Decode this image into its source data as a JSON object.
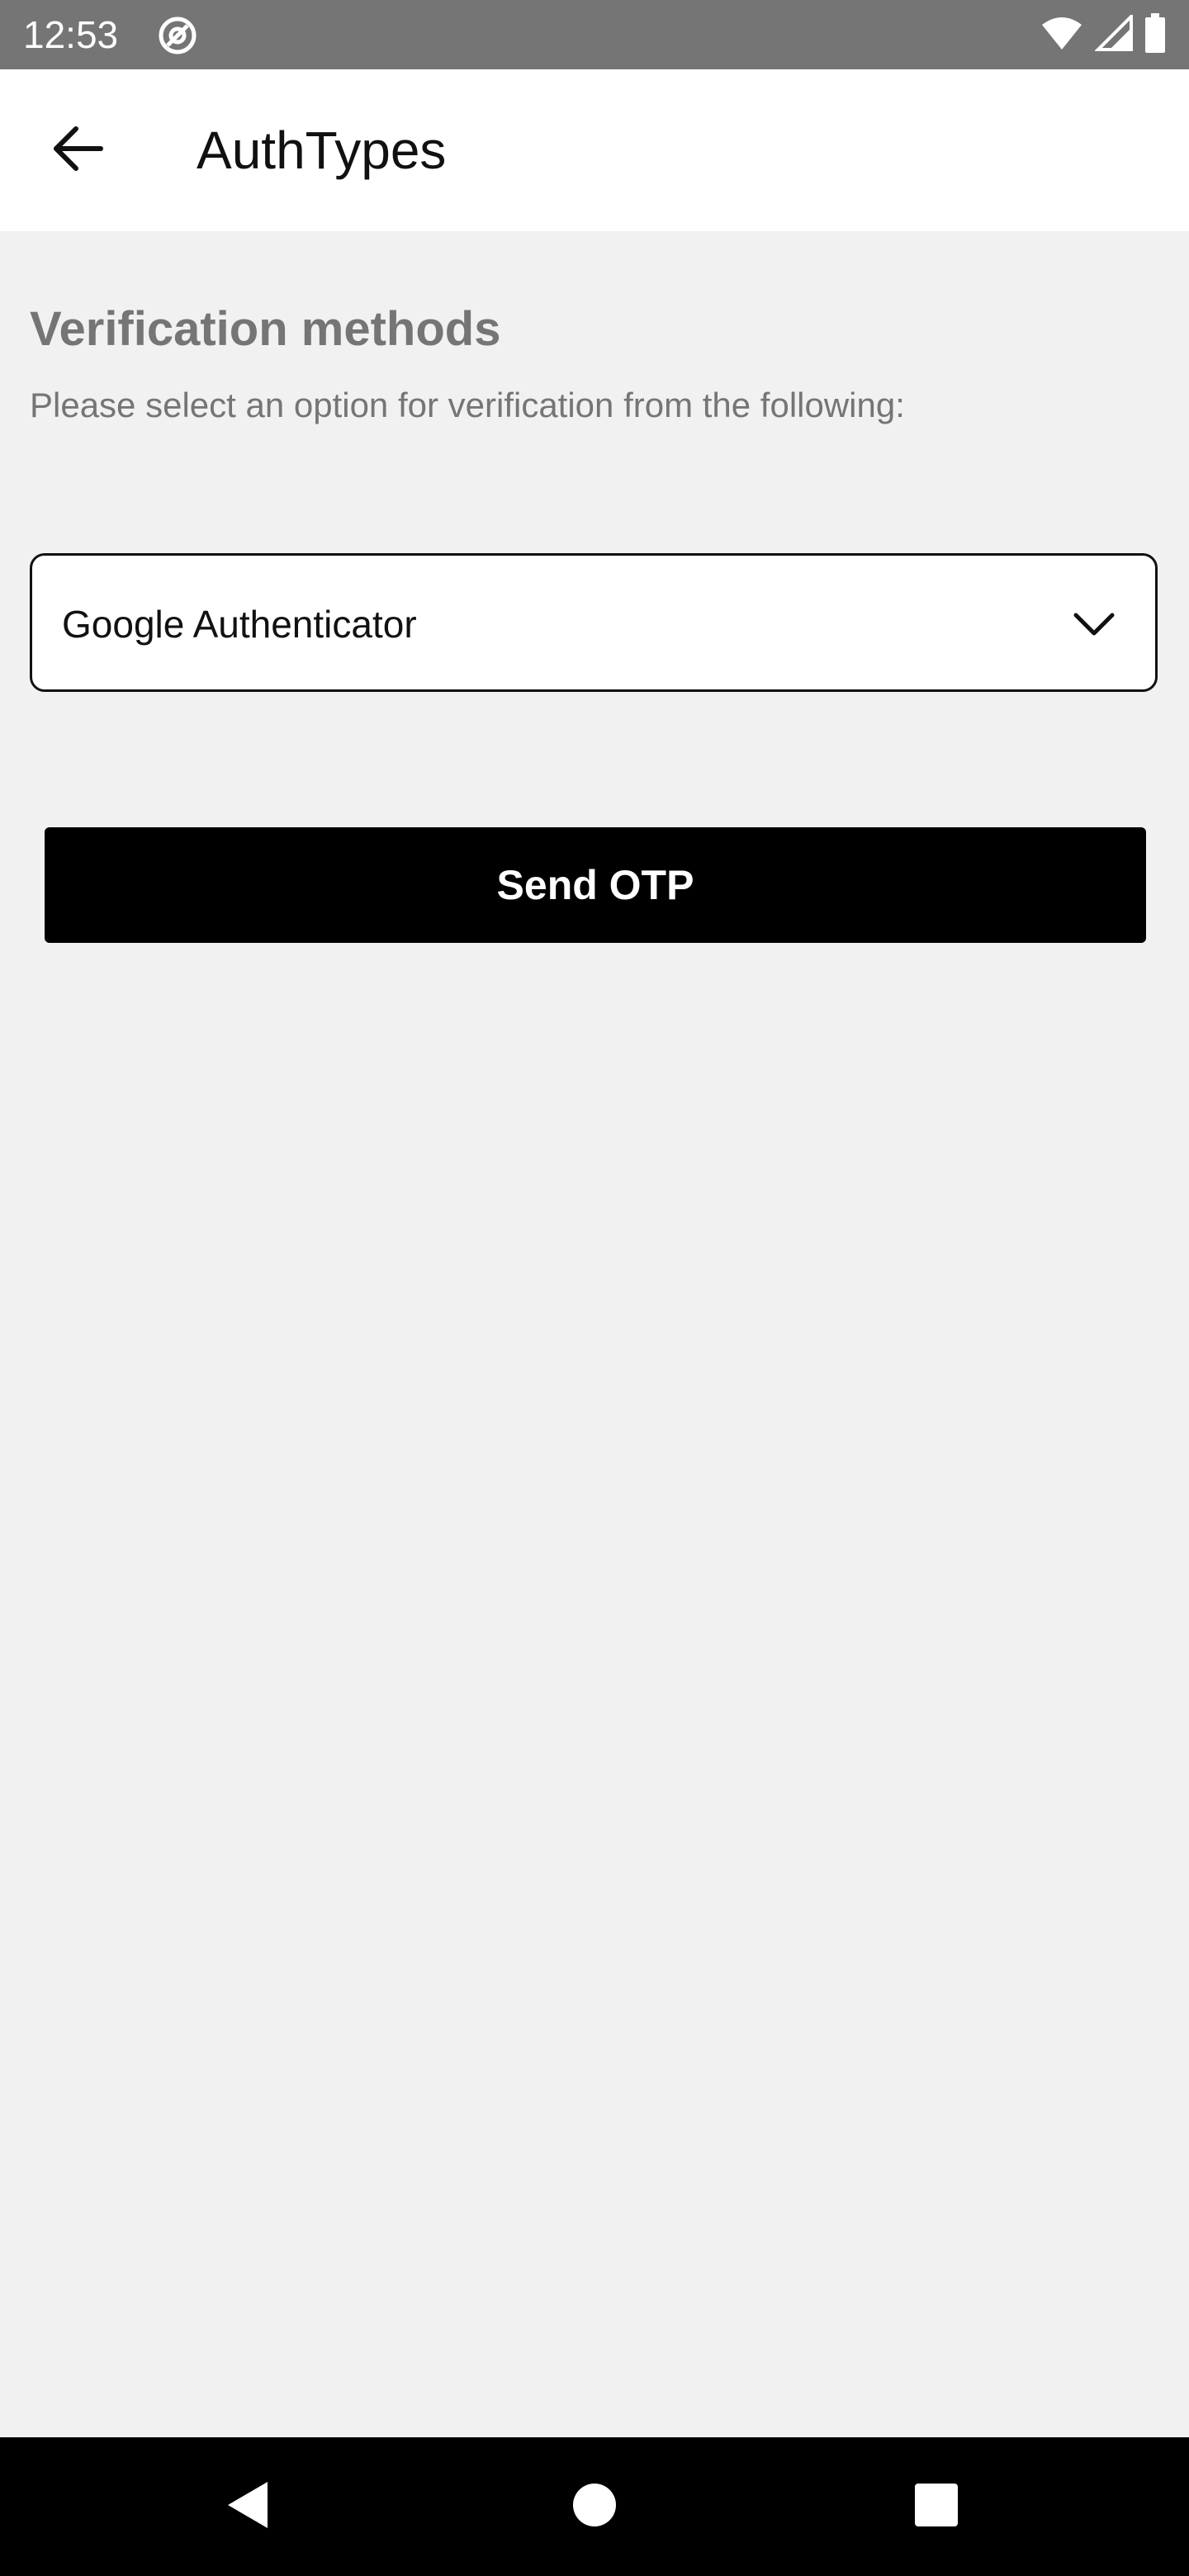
{
  "status_bar": {
    "time": "12:53",
    "icons": [
      "at-sign-icon",
      "wifi-icon",
      "signal-icon",
      "battery-icon"
    ]
  },
  "app_bar": {
    "back_icon": "arrow-left-icon",
    "title": "AuthTypes"
  },
  "verification": {
    "title": "Verification methods",
    "subtitle": "Please select an option for verification from the following:",
    "dropdown": {
      "selected": "Google Authenticator",
      "icon": "chevron-down-icon"
    },
    "send_button_label": "Send OTP"
  },
  "nav_bar": {
    "icons": [
      "nav-back-icon",
      "nav-home-icon",
      "nav-recents-icon"
    ]
  },
  "colors": {
    "status_bar_bg": "#757575",
    "app_bar_bg": "#ffffff",
    "page_bg": "#f1f1f1",
    "secondary_text": "#757575",
    "primary_button": "#000000",
    "nav_bar_bg": "#000000"
  }
}
